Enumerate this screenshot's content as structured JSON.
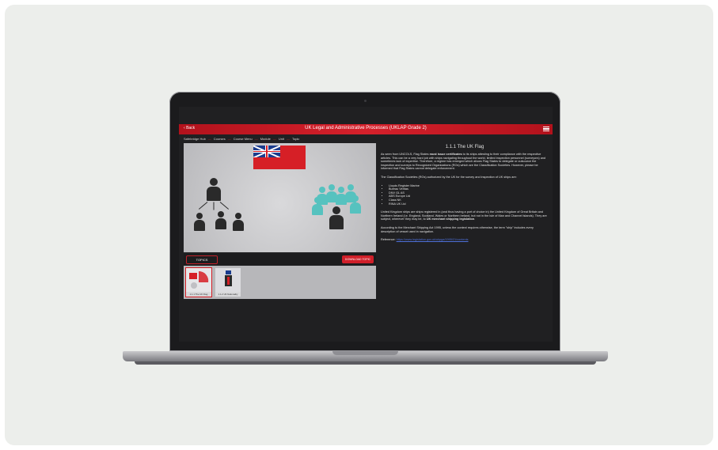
{
  "app": {
    "back_label": "Back",
    "title": "UK Legal and Administrative Processes (UKLAP Grade 2)",
    "menu_icon": "hamburger-icon"
  },
  "breadcrumb": [
    "Safebridge Hub",
    "Courses",
    "Course Menu",
    "Module",
    "Unit",
    "Topic"
  ],
  "toolbar": {
    "topics_label": "TOPICS",
    "download_label": "DOWNLOAD TOPIC"
  },
  "thumbnails": [
    {
      "label": "1.1.1 The UK Flag"
    },
    {
      "label": "1.1.2 UK Nationality"
    }
  ],
  "content": {
    "heading": "1.1.1 The UK Flag",
    "para1_a": "As seen from UNCOLS, Flag States ",
    "para1_b": "must issue certificates",
    "para1_c": " to its ships attesting to their compliance with the respective articles. This can be a very hard job with ships navigating throughout the world, limited inspection personnel (surveyors) and sometimes lack of expertise. Therefore, a regime has emerged which allows Flag States to delegate or outsource the inspection and surveys to Recognized Organizations (ROs) which are the Classification Societies. However, please be informed that Flag States cannot delegate enforcement.",
    "para2": "The Classification Societies (ROs) authorized by the UK for the survey and inspection of UK ships are:",
    "list": [
      "Lloyds Register Marine",
      "Bureau Veritas",
      "DNV GL AS",
      "ABS Europe Ltd",
      "Class NK",
      "RINA UK Ltd"
    ],
    "para3_a": "United Kingdom ships are ships registered in (and thus having a port of choice in) the United Kingdom of Great Britain and Northern Ireland (i.e. England, Scotland, Wales or Northern Ireland, but not in the Isle of Man and Channel Islands). They are subject, wherever they may be, to ",
    "para3_b": "UK merchant shipping legislation",
    "para3_c": ".",
    "para4": "According to the Merchant Shipping Act 1995, unless the context requires otherwise, the term \"ship\" includes every description of vessel used in navigation.",
    "ref_label": "Reference:",
    "ref_link": "https://www.legislation.gov.uk/ukpga/1995/21/contents"
  }
}
